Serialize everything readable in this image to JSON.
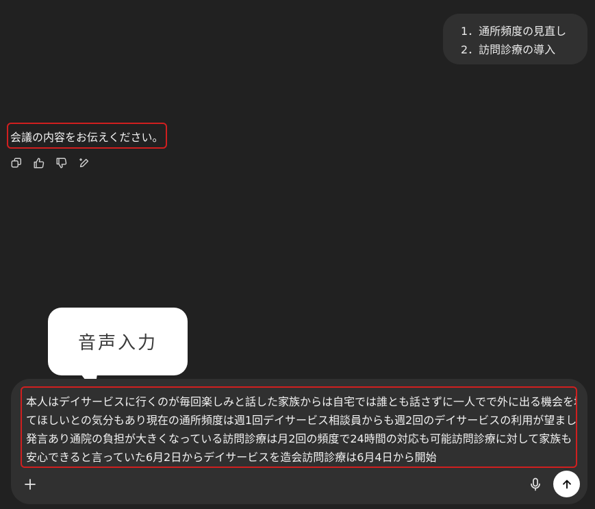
{
  "user_message": {
    "lines": [
      "1．通所頻度の見直し",
      "2．訪問診療の導入"
    ]
  },
  "assistant_message": {
    "text": "会議の内容をお伝えください。"
  },
  "message_actions": {
    "icons": [
      "copy-icon",
      "thumbs-up-icon",
      "thumbs-down-icon",
      "edit-icon"
    ]
  },
  "callout": {
    "text": "音声入力"
  },
  "composer": {
    "lines": [
      "本人はデイサービスに行くのが毎回楽しみと話した家族からは自宅では誰とも話さずに一人でで外に出る機会を増やし",
      "てほしいとの気分もあり現在の通所頻度は週1回デイサービス相談員からも週2回のデイサービスの利用が望ましいとの",
      "発言あり通院の負担が大きくなっている訪問診療は月2回の頻度で24時間の対応も可能訪問診療に対して家族も",
      "安心できると言っていた6月2日からデイサービスを造会訪問診療は6月4日から開始"
    ],
    "icons": [
      "plus-icon",
      "microphone-icon",
      "arrow-up-icon"
    ]
  },
  "colors": {
    "background": "#212121",
    "bubble": "#303030",
    "highlight_border": "#d11f1f",
    "callout_bg": "#ffffff"
  }
}
